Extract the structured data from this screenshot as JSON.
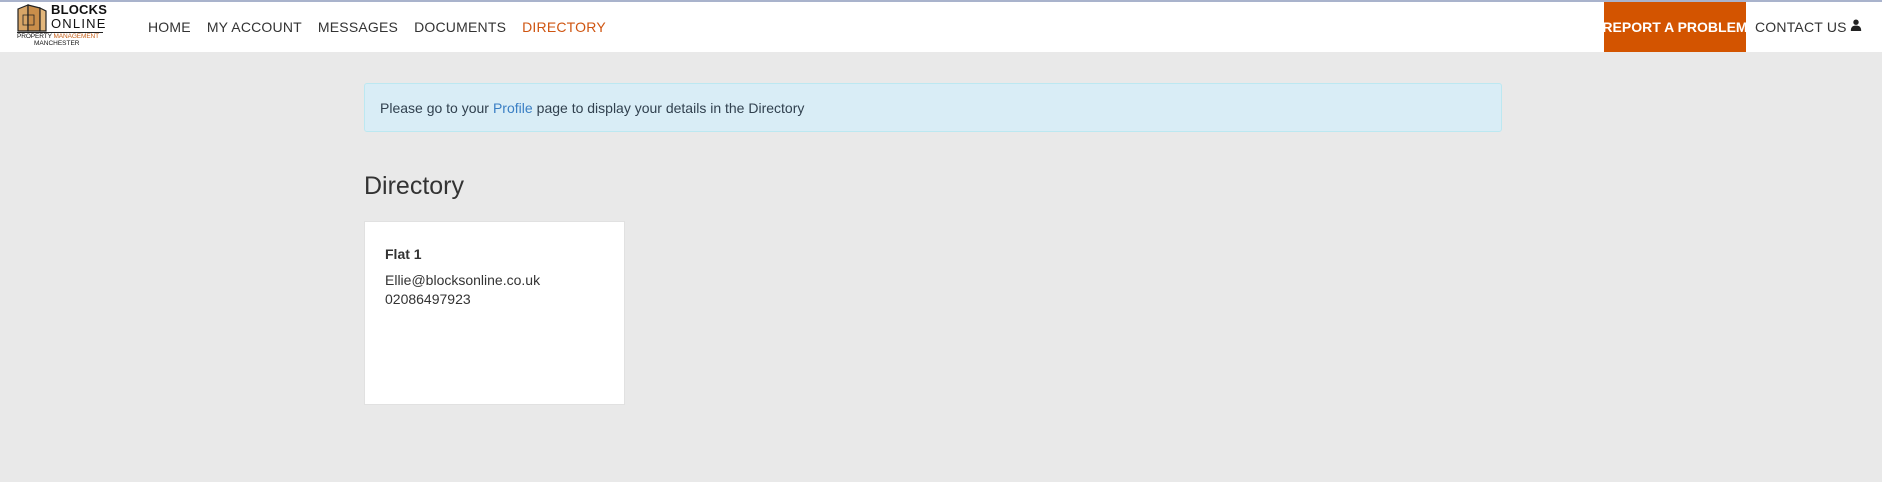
{
  "brand": {
    "name_line1": "BLOCKS",
    "name_line2": "ONLINE",
    "tagline_part1": "PROPERTY ",
    "tagline_part2": "MANAGEMENT",
    "city": "MANCHESTER",
    "accent_color": "#d35400"
  },
  "nav": {
    "items": [
      {
        "label": "HOME"
      },
      {
        "label": "MY ACCOUNT"
      },
      {
        "label": "MESSAGES"
      },
      {
        "label": "DOCUMENTS"
      },
      {
        "label": "DIRECTORY",
        "active": true
      }
    ],
    "report_label": "REPORT A PROBLEM",
    "contact_label": "CONTACT US",
    "user_icon": "user-icon"
  },
  "alert": {
    "text_before": "Please go to your",
    "link_text": "Profile",
    "text_after": "page to display your details in the Directory"
  },
  "page": {
    "title": "Directory"
  },
  "directory": {
    "entries": [
      {
        "name": "Flat 1",
        "email": "Ellie@blocksonline.co.uk",
        "phone": "02086497923"
      }
    ]
  }
}
